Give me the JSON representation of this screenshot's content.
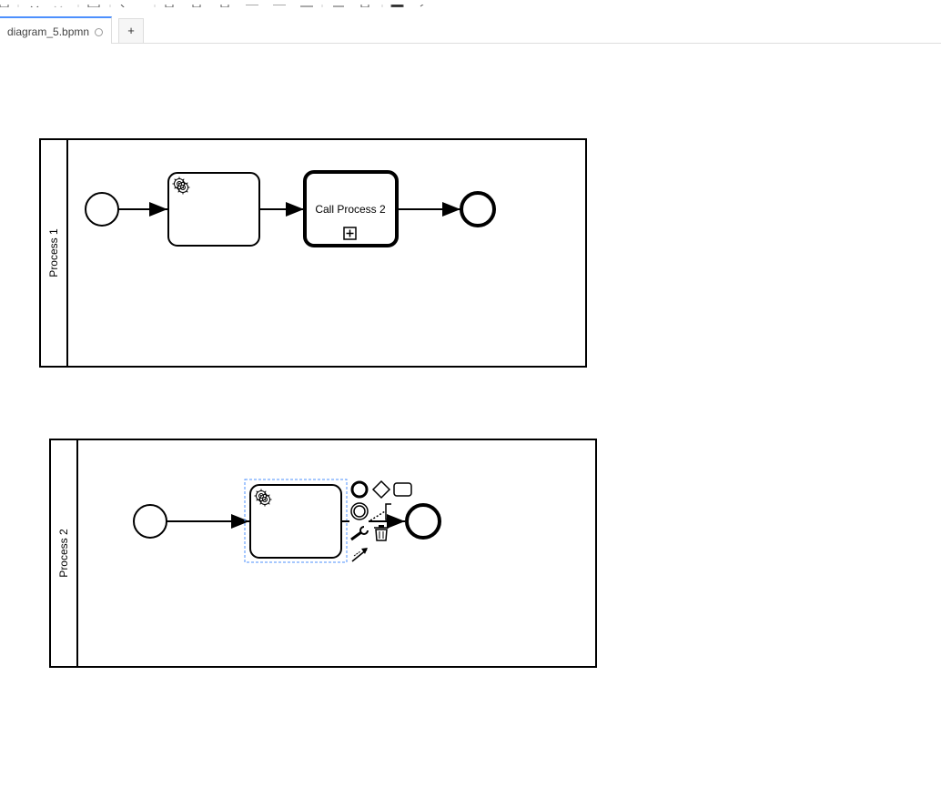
{
  "tabs": [
    {
      "label": "diagram_5.bpmn",
      "unsaved_indicator": "circle-icon",
      "active": true
    }
  ],
  "add_tab_label": "+",
  "pools": [
    {
      "name": "Process 1"
    },
    {
      "name": "Process 2"
    }
  ],
  "call_activity": {
    "label": "Call Process 2",
    "marker": "collapsed-subprocess-plus-icon"
  },
  "task_marker_icon": "gear-icon",
  "context_pad": [
    "end-event-icon",
    "gateway-icon",
    "task-icon",
    "intermediate-event-icon",
    "text-annotation-icon",
    "wrench-icon",
    "delete-icon",
    "connect-icon"
  ],
  "colors": {
    "accent": "#4d90fe",
    "selection": "#4d90fe",
    "stroke": "#000000"
  }
}
